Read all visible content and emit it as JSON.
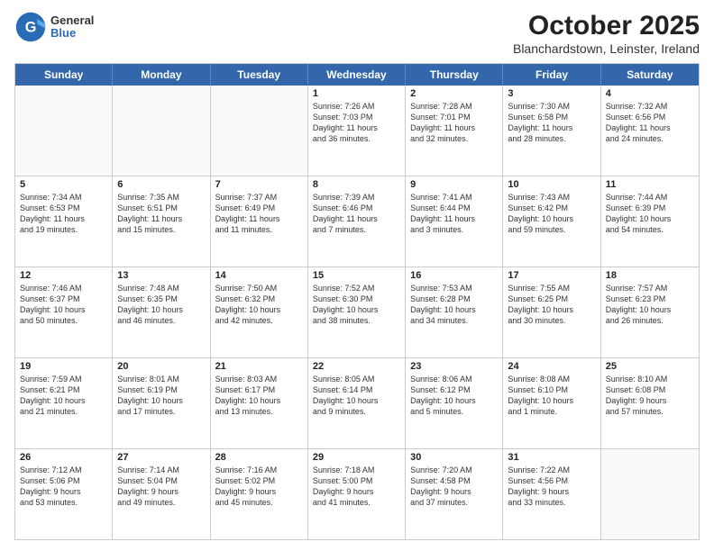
{
  "logo": {
    "line1": "General",
    "line2": "Blue"
  },
  "title": "October 2025",
  "subtitle": "Blanchardstown, Leinster, Ireland",
  "days": [
    "Sunday",
    "Monday",
    "Tuesday",
    "Wednesday",
    "Thursday",
    "Friday",
    "Saturday"
  ],
  "weeks": [
    [
      {
        "day": "",
        "info": "",
        "empty": true
      },
      {
        "day": "",
        "info": "",
        "empty": true
      },
      {
        "day": "",
        "info": "",
        "empty": true
      },
      {
        "day": "1",
        "info": "Sunrise: 7:26 AM\nSunset: 7:03 PM\nDaylight: 11 hours\nand 36 minutes.",
        "empty": false
      },
      {
        "day": "2",
        "info": "Sunrise: 7:28 AM\nSunset: 7:01 PM\nDaylight: 11 hours\nand 32 minutes.",
        "empty": false
      },
      {
        "day": "3",
        "info": "Sunrise: 7:30 AM\nSunset: 6:58 PM\nDaylight: 11 hours\nand 28 minutes.",
        "empty": false
      },
      {
        "day": "4",
        "info": "Sunrise: 7:32 AM\nSunset: 6:56 PM\nDaylight: 11 hours\nand 24 minutes.",
        "empty": false
      }
    ],
    [
      {
        "day": "5",
        "info": "Sunrise: 7:34 AM\nSunset: 6:53 PM\nDaylight: 11 hours\nand 19 minutes.",
        "empty": false
      },
      {
        "day": "6",
        "info": "Sunrise: 7:35 AM\nSunset: 6:51 PM\nDaylight: 11 hours\nand 15 minutes.",
        "empty": false
      },
      {
        "day": "7",
        "info": "Sunrise: 7:37 AM\nSunset: 6:49 PM\nDaylight: 11 hours\nand 11 minutes.",
        "empty": false
      },
      {
        "day": "8",
        "info": "Sunrise: 7:39 AM\nSunset: 6:46 PM\nDaylight: 11 hours\nand 7 minutes.",
        "empty": false
      },
      {
        "day": "9",
        "info": "Sunrise: 7:41 AM\nSunset: 6:44 PM\nDaylight: 11 hours\nand 3 minutes.",
        "empty": false
      },
      {
        "day": "10",
        "info": "Sunrise: 7:43 AM\nSunset: 6:42 PM\nDaylight: 10 hours\nand 59 minutes.",
        "empty": false
      },
      {
        "day": "11",
        "info": "Sunrise: 7:44 AM\nSunset: 6:39 PM\nDaylight: 10 hours\nand 54 minutes.",
        "empty": false
      }
    ],
    [
      {
        "day": "12",
        "info": "Sunrise: 7:46 AM\nSunset: 6:37 PM\nDaylight: 10 hours\nand 50 minutes.",
        "empty": false
      },
      {
        "day": "13",
        "info": "Sunrise: 7:48 AM\nSunset: 6:35 PM\nDaylight: 10 hours\nand 46 minutes.",
        "empty": false
      },
      {
        "day": "14",
        "info": "Sunrise: 7:50 AM\nSunset: 6:32 PM\nDaylight: 10 hours\nand 42 minutes.",
        "empty": false
      },
      {
        "day": "15",
        "info": "Sunrise: 7:52 AM\nSunset: 6:30 PM\nDaylight: 10 hours\nand 38 minutes.",
        "empty": false
      },
      {
        "day": "16",
        "info": "Sunrise: 7:53 AM\nSunset: 6:28 PM\nDaylight: 10 hours\nand 34 minutes.",
        "empty": false
      },
      {
        "day": "17",
        "info": "Sunrise: 7:55 AM\nSunset: 6:25 PM\nDaylight: 10 hours\nand 30 minutes.",
        "empty": false
      },
      {
        "day": "18",
        "info": "Sunrise: 7:57 AM\nSunset: 6:23 PM\nDaylight: 10 hours\nand 26 minutes.",
        "empty": false
      }
    ],
    [
      {
        "day": "19",
        "info": "Sunrise: 7:59 AM\nSunset: 6:21 PM\nDaylight: 10 hours\nand 21 minutes.",
        "empty": false
      },
      {
        "day": "20",
        "info": "Sunrise: 8:01 AM\nSunset: 6:19 PM\nDaylight: 10 hours\nand 17 minutes.",
        "empty": false
      },
      {
        "day": "21",
        "info": "Sunrise: 8:03 AM\nSunset: 6:17 PM\nDaylight: 10 hours\nand 13 minutes.",
        "empty": false
      },
      {
        "day": "22",
        "info": "Sunrise: 8:05 AM\nSunset: 6:14 PM\nDaylight: 10 hours\nand 9 minutes.",
        "empty": false
      },
      {
        "day": "23",
        "info": "Sunrise: 8:06 AM\nSunset: 6:12 PM\nDaylight: 10 hours\nand 5 minutes.",
        "empty": false
      },
      {
        "day": "24",
        "info": "Sunrise: 8:08 AM\nSunset: 6:10 PM\nDaylight: 10 hours\nand 1 minute.",
        "empty": false
      },
      {
        "day": "25",
        "info": "Sunrise: 8:10 AM\nSunset: 6:08 PM\nDaylight: 9 hours\nand 57 minutes.",
        "empty": false
      }
    ],
    [
      {
        "day": "26",
        "info": "Sunrise: 7:12 AM\nSunset: 5:06 PM\nDaylight: 9 hours\nand 53 minutes.",
        "empty": false
      },
      {
        "day": "27",
        "info": "Sunrise: 7:14 AM\nSunset: 5:04 PM\nDaylight: 9 hours\nand 49 minutes.",
        "empty": false
      },
      {
        "day": "28",
        "info": "Sunrise: 7:16 AM\nSunset: 5:02 PM\nDaylight: 9 hours\nand 45 minutes.",
        "empty": false
      },
      {
        "day": "29",
        "info": "Sunrise: 7:18 AM\nSunset: 5:00 PM\nDaylight: 9 hours\nand 41 minutes.",
        "empty": false
      },
      {
        "day": "30",
        "info": "Sunrise: 7:20 AM\nSunset: 4:58 PM\nDaylight: 9 hours\nand 37 minutes.",
        "empty": false
      },
      {
        "day": "31",
        "info": "Sunrise: 7:22 AM\nSunset: 4:56 PM\nDaylight: 9 hours\nand 33 minutes.",
        "empty": false
      },
      {
        "day": "",
        "info": "",
        "empty": true
      }
    ]
  ]
}
